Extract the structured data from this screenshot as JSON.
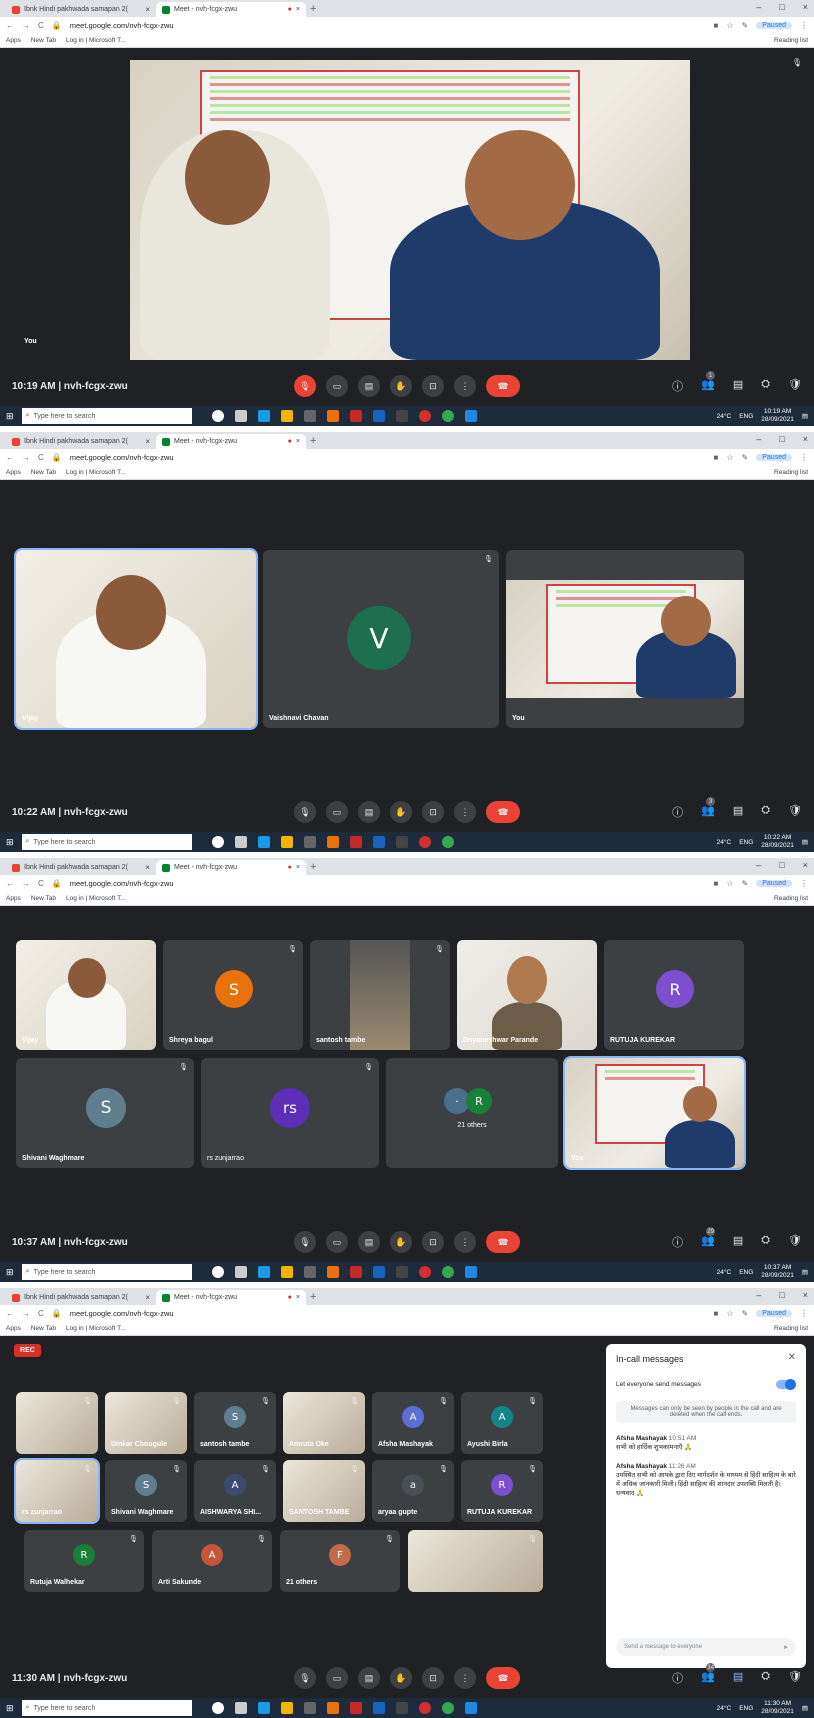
{
  "browser": {
    "tab1_title": "Ibnk Hindi pakhwada samapan 2(",
    "tab2_title": "Meet - nvh-fcgx-zwu",
    "url": "meet.google.com/nvh-fcgx-zwu",
    "paused_label": "Paused",
    "bookmarks": [
      "Apps",
      "New Tab",
      "Log in | Microsoft T..."
    ],
    "reading_list": "Reading list"
  },
  "taskbar": {
    "search_placeholder": "Type here to search",
    "weather": "24°C",
    "lang": "ENG",
    "date": "28/09/2021"
  },
  "shot1": {
    "time": "10:19 AM",
    "meeting": "nvh-fcgx-zwu",
    "self_label": "You",
    "participants_badge": "1",
    "clock": "10:19 AM"
  },
  "shot2": {
    "time": "10:22 AM",
    "meeting": "nvh-fcgx-zwu",
    "tiles": [
      {
        "name": "Vijay"
      },
      {
        "name": "Vaishnavi Chavan",
        "initial": "V",
        "color": "#1e6e50"
      },
      {
        "name": "You"
      }
    ],
    "participants_badge": "3",
    "clock": "10:22 AM"
  },
  "shot3": {
    "time": "10:37 AM",
    "meeting": "nvh-fcgx-zwu",
    "row1": [
      {
        "name": "Vijay"
      },
      {
        "name": "Shreya bagul",
        "initial": "S",
        "color": "#e8710a"
      },
      {
        "name": "santosh tambe"
      },
      {
        "name": "Dnyaneshwar Parande"
      },
      {
        "name": "RUTUJA KUREKAR",
        "initial": "R",
        "color": "#7b4fcf"
      }
    ],
    "row2": [
      {
        "name": "Shivani Waghmare",
        "initial": "S",
        "color": "#5f7f8f"
      },
      {
        "name": "rs zunjarrao",
        "initial": "rs",
        "color": "#5b2fb8"
      },
      {
        "name": "21 others",
        "initial": "R",
        "color": "#188038"
      },
      {
        "name": "You"
      }
    ],
    "participants_badge": "29",
    "clock": "10:37 AM"
  },
  "shot4": {
    "time": "11:30 AM",
    "meeting": "nvh-fcgx-zwu",
    "rec_label": "REC",
    "grid": [
      {
        "name": ""
      },
      {
        "name": "Dinkar Chougule"
      },
      {
        "name": "santosh tambe",
        "initial": "S",
        "color": "#5f7f8f"
      },
      {
        "name": "Amruta Oke"
      },
      {
        "name": "Afsha Mashayak",
        "initial": "A",
        "color": "#5b6fd6"
      },
      {
        "name": "Ayushi Birla",
        "initial": "A",
        "color": "#12858a"
      },
      {
        "name": "rs zunjarrao"
      },
      {
        "name": "Shivani Waghmare",
        "initial": "S",
        "color": "#5f7f8f"
      },
      {
        "name": "AISHWARYA SHI...",
        "initial": "A",
        "color": "#3c4a6e"
      },
      {
        "name": "SANTOSH TAMBE"
      },
      {
        "name": "aryaa gupte",
        "initial": "a",
        "color": "#4a4f56"
      },
      {
        "name": "RUTUJA KUREKAR",
        "initial": "R",
        "color": "#7b4fcf"
      },
      {
        "name": "Rutuja Walhekar",
        "initial": "R",
        "color": "#188038"
      },
      {
        "name": "Arti Sakunde",
        "initial": "A",
        "color": "#c5563a"
      },
      {
        "name": "21 others",
        "initial": "F",
        "color": "#c26a4a"
      },
      {
        "name": ""
      }
    ],
    "panel": {
      "title": "In-call messages",
      "toggle_label": "Let everyone send messages",
      "note": "Messages can only be seen by people in the call and are deleted when the call ends.",
      "messages": [
        {
          "sender": "Afsha Mashayak",
          "time": "10:51 AM",
          "text": "सभी को हार्दिक शुभकामनाएँ 🙏"
        },
        {
          "sender": "Afsha Mashayak",
          "time": "11:26 AM",
          "text": "उपस्थित सभी को आपके द्वारा दिए मार्गदर्शन के माध्यम से हिंदी साहित्य के बारे में अधिक जानकारी मिली। हिंदी साहित्य की शानदार उपलब्धि मिलती है। धन्यवाद 🙏"
        }
      ],
      "send_placeholder": "Send a message to everyone"
    },
    "participants_badge": "34",
    "clock": "11:30 AM"
  }
}
